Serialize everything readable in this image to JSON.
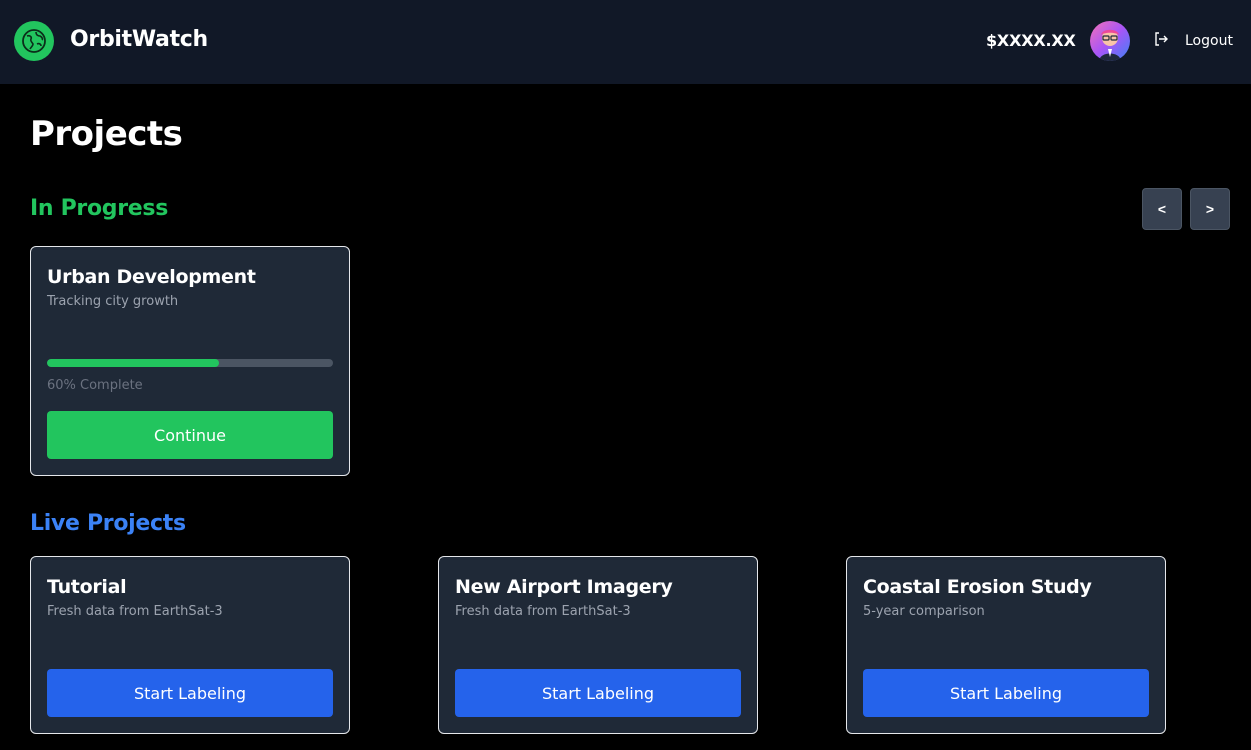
{
  "header": {
    "brand": "OrbitWatch",
    "balance": "$XXXX.XX",
    "logout_label": "Logout"
  },
  "main": {
    "title": "Projects",
    "in_progress": {
      "heading": "In Progress",
      "prev_label": "<",
      "next_label": ">",
      "items": [
        {
          "title": "Urban Development",
          "subtitle": "Tracking city growth",
          "progress": 0.6,
          "progress_label": "60% Complete",
          "button_label": "Continue"
        }
      ]
    },
    "live": {
      "heading": "Live Projects",
      "items": [
        {
          "title": "Tutorial",
          "subtitle": "Fresh data from EarthSat-3",
          "button_label": "Start Labeling"
        },
        {
          "title": "New Airport Imagery",
          "subtitle": "Fresh data from EarthSat-3",
          "button_label": "Start Labeling"
        },
        {
          "title": "Coastal Erosion Study",
          "subtitle": "5-year comparison",
          "button_label": "Start Labeling"
        }
      ]
    }
  },
  "colors": {
    "header_bg": "#111827",
    "page_bg": "#000000",
    "card_bg": "#1f2937",
    "green_accent": "#22c55e",
    "blue_accent": "#3b82f6",
    "blue_button": "#2563eb"
  },
  "icons": {
    "logo": "globe-icon",
    "avatar": "user-avatar",
    "logout": "logout-icon"
  }
}
